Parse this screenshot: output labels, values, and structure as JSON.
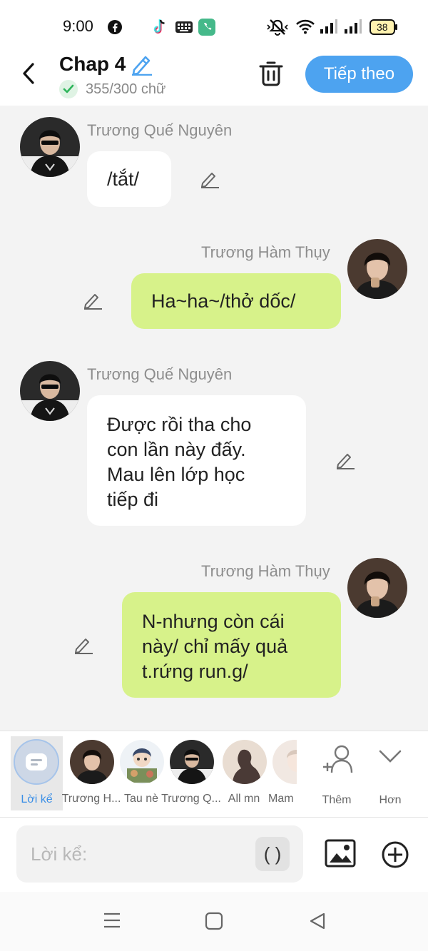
{
  "status_bar": {
    "time": "9:00",
    "battery": "38",
    "icons": [
      "facebook-icon",
      "tiktok-icon",
      "keyboard-icon",
      "phone-icon",
      "mute-icon",
      "wifi-icon",
      "signal-icon",
      "signal-2-icon",
      "battery-icon"
    ]
  },
  "header": {
    "title": "Chap 4",
    "word_count": "355/300 chữ",
    "next_label": "Tiếp theo",
    "accent_color": "#4da3f0"
  },
  "messages": [
    {
      "sender": "Trương Quế Nguyên",
      "text": "/tắt/",
      "side": "left"
    },
    {
      "sender": "Trương Hàm Thụy",
      "text": "Ha~ha~/thở dốc/",
      "side": "right"
    },
    {
      "sender": "Trương Quế Nguyên",
      "lines": [
        "Được rồi tha cho",
        "con lần này đấy.",
        "Mau lên lớp học",
        "tiếp đi"
      ],
      "side": "left"
    },
    {
      "sender": "Trương Hàm Thụy",
      "lines": [
        "N-nhưng còn cái",
        "này/ chỉ mấy quả",
        "t.rứng run.g/"
      ],
      "side": "right"
    }
  ],
  "characters": [
    {
      "name": "Lời kể"
    },
    {
      "name": "Trương H..."
    },
    {
      "name": "Tau nè"
    },
    {
      "name": "Trương Q..."
    },
    {
      "name": "All mn"
    },
    {
      "name": "Mam"
    }
  ],
  "tools": {
    "add_label": "Thêm",
    "more_label": "Hơn"
  },
  "composer": {
    "placeholder": "Lời kể:",
    "paren_label": "( )"
  },
  "colors": {
    "left_bubble": "#ffffff",
    "right_bubble": "#d7f28a",
    "background": "#f3f3f3"
  }
}
